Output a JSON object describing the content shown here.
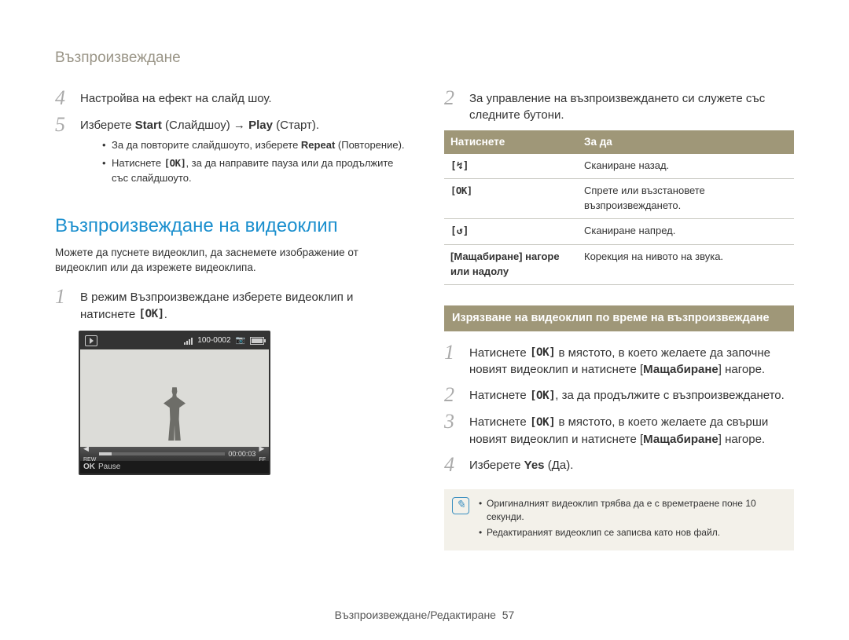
{
  "breadcrumb": "Възпроизвеждане",
  "left": {
    "steps45": {
      "s4": "Настройва на ефект на слайд шоу.",
      "s5_pre": "Изберете ",
      "s5_b1": "Start",
      "s5_paren1": " (Слайдшоу) → ",
      "s5_b2": "Play",
      "s5_paren2": " (Старт).",
      "bullets": {
        "b1_pre": "За да повторите слайдшоуто, изберете ",
        "b1_b": "Repeat",
        "b1_post": " (Повторение).",
        "b2_pre": "Натиснете ",
        "b2_post": ", за да направите пауза или да продължите със слайдшоуто."
      }
    },
    "section_h": "Възпроизвеждане на видеоклип",
    "section_intro": "Можете да пуснете видеоклип, да заснемете изображение от видеоклип или да изрежете видеоклипа.",
    "step1_pre": "В режим Възпроизвеждане изберете видеоклип и натиснете ",
    "step1_post": ".",
    "video": {
      "counter": "100-0002",
      "time": "00:00:03",
      "rew": "REW",
      "ff": "FF",
      "ok": "OK",
      "pause": "Pause"
    }
  },
  "right": {
    "s2": "За управление на възпроизвеждането си служете със следните бутони.",
    "table": {
      "h1": "Натиснете",
      "h2": "За да",
      "r1c1_icon": "[↯]",
      "r1c2": "Сканиране назад.",
      "r2c2": "Спрете или възстановете възпроизвеждането.",
      "r3c1_icon": "[↺]",
      "r3c2": "Сканиране напред.",
      "r4c1": "[Мащабиране] нагоре или надолу",
      "r4c2": "Корекция на нивото на звука."
    },
    "banner": "Изрязване на видеоклип по време на възпроизвеждане",
    "trim": {
      "s1_pre": "Натиснете ",
      "s1_mid": " в мястото, в което желаете да започне новият видеоклип и натиснете [",
      "s1_b": "Мащабиране",
      "s1_post": "] нагоре.",
      "s2_pre": "Натиснете ",
      "s2_post": ", за да продължите с възпроизвеждането.",
      "s3_pre": "Натиснете ",
      "s3_mid": " в мястото, в което желаете да свърши новият видеоклип и натиснете [",
      "s3_b": "Мащабиране",
      "s3_post": "] нагоре.",
      "s4_pre": "Изберете ",
      "s4_b": "Yes",
      "s4_post": " (Да)."
    },
    "note": {
      "n1": "Оригиналният видеоклип трябва да е с времетраене поне 10 секунди.",
      "n2": "Редактираният видеоклип се записва като нов файл."
    }
  },
  "footer": {
    "label": "Възпроизвеждане/Редактиране",
    "page": "57"
  }
}
